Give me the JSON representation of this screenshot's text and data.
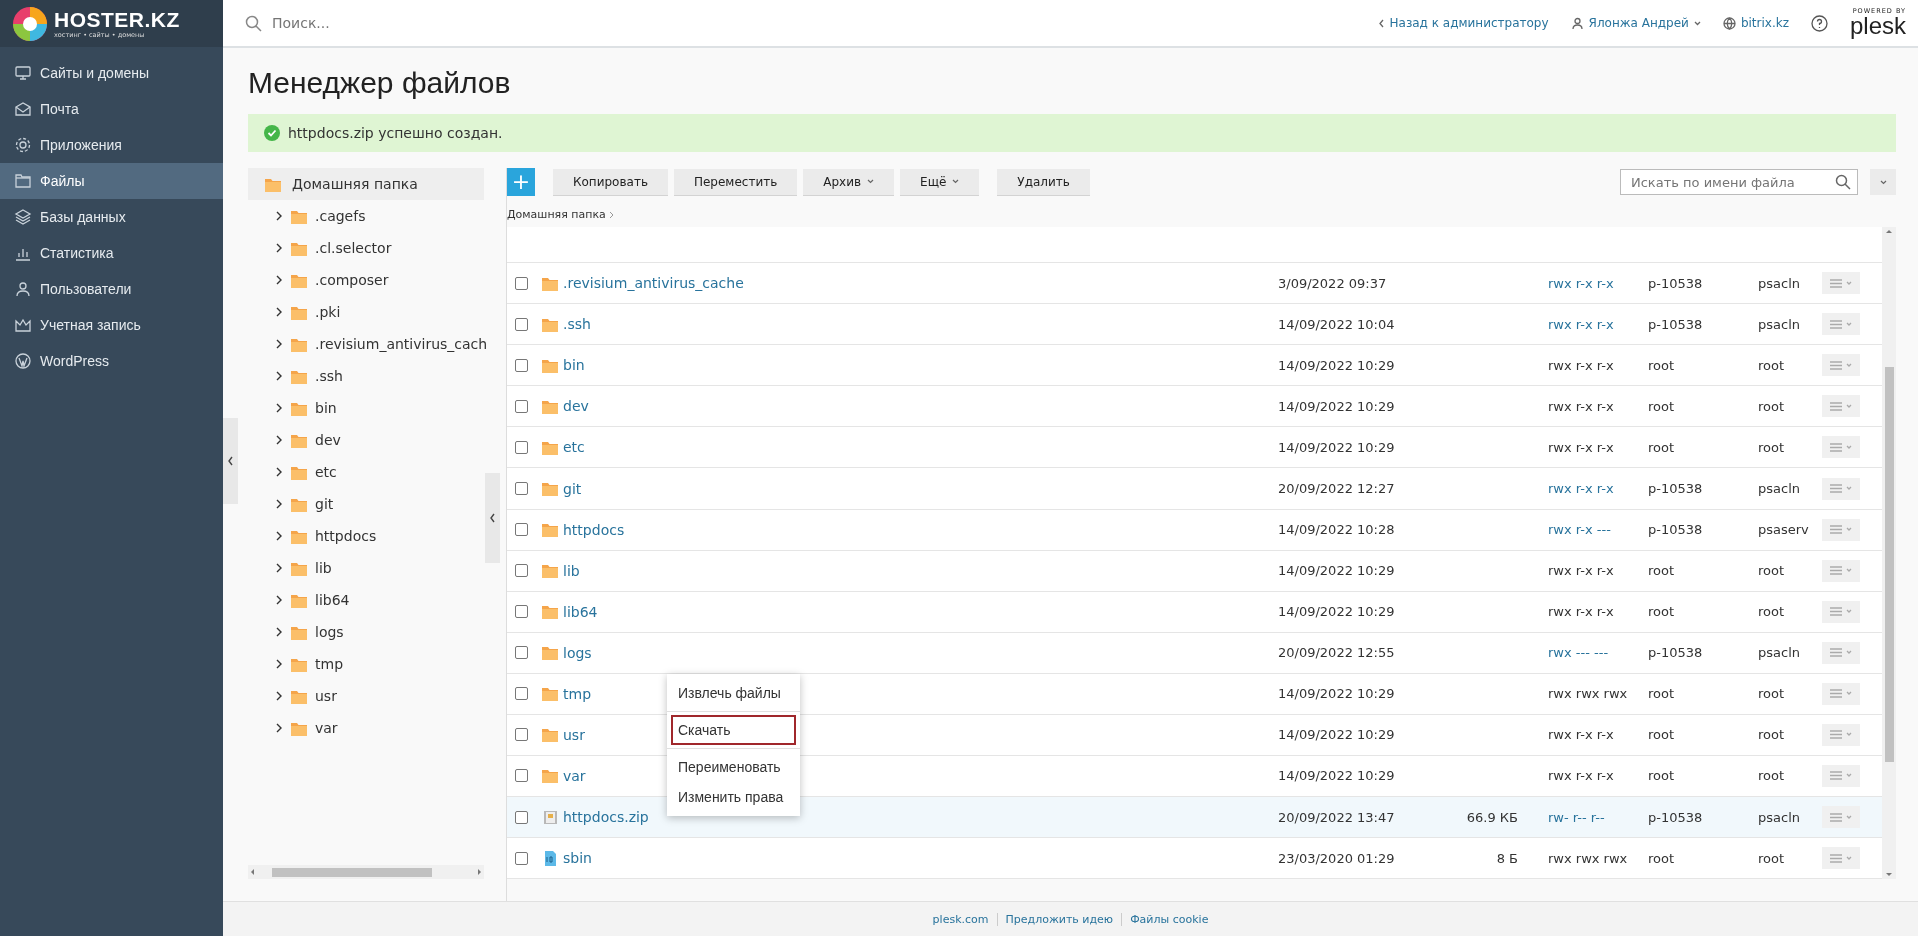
{
  "brand": {
    "name": "HOSTER",
    "suffix": ".KZ",
    "tagline": "хостинг • сайты • домены"
  },
  "sidebar": {
    "items": [
      {
        "label": "Сайты и домены",
        "selected": false
      },
      {
        "label": "Почта",
        "selected": false
      },
      {
        "label": "Приложения",
        "selected": false
      },
      {
        "label": "Файлы",
        "selected": true
      },
      {
        "label": "Базы данных",
        "selected": false
      },
      {
        "label": "Статистика",
        "selected": false
      },
      {
        "label": "Пользователи",
        "selected": false
      },
      {
        "label": "Учетная запись",
        "selected": false
      },
      {
        "label": "WordPress",
        "selected": false
      }
    ]
  },
  "topbar": {
    "search_placeholder": "Поиск...",
    "back_link": "Назад к администратору",
    "user": "Ялонжа Андрей",
    "domain": "bitrix.kz",
    "powered_by": "POWERED BY",
    "plesk": "plesk"
  },
  "page_title": "Менеджер файлов",
  "message": "httpdocs.zip успешно создан.",
  "tree": {
    "root": {
      "label": "Домашняя папка"
    },
    "children": [
      ".cagefs",
      ".cl.selector",
      ".composer",
      ".pki",
      ".revisium_antivirus_cach",
      ".ssh",
      "bin",
      "dev",
      "etc",
      "git",
      "httpdocs",
      "lib",
      "lib64",
      "logs",
      "tmp",
      "usr",
      "var"
    ]
  },
  "toolbar": {
    "add": "+",
    "buttons": [
      {
        "label": "Копировать",
        "dropdown": false
      },
      {
        "label": "Переместить",
        "dropdown": false
      },
      {
        "label": "Архив",
        "dropdown": true
      },
      {
        "label": "Ещё",
        "dropdown": true
      },
      {
        "label": "Удалить",
        "dropdown": false
      }
    ],
    "search_placeholder": "Искать по имени файла"
  },
  "breadcrumb": "Домашняя папка",
  "rows": [
    {
      "name": ".revisium_antivirus_cache",
      "kind": "folder",
      "date": "3/09/2022 09:37",
      "perms": "rwx r-x r-x",
      "perms_link": true,
      "owner": "p-10538",
      "group": "psacln",
      "highlighted": false
    },
    {
      "name": ".ssh",
      "kind": "folder",
      "date": "14/09/2022 10:04",
      "perms": "rwx r-x r-x",
      "perms_link": true,
      "owner": "p-10538",
      "group": "psacln",
      "highlighted": false
    },
    {
      "name": "bin",
      "kind": "folder",
      "date": "14/09/2022 10:29",
      "perms": "rwx r-x r-x",
      "perms_link": false,
      "owner": "root",
      "group": "root",
      "highlighted": false
    },
    {
      "name": "dev",
      "kind": "folder",
      "date": "14/09/2022 10:29",
      "perms": "rwx r-x r-x",
      "perms_link": false,
      "owner": "root",
      "group": "root",
      "highlighted": false
    },
    {
      "name": "etc",
      "kind": "folder",
      "date": "14/09/2022 10:29",
      "perms": "rwx r-x r-x",
      "perms_link": false,
      "owner": "root",
      "group": "root",
      "highlighted": false
    },
    {
      "name": "git",
      "kind": "folder",
      "date": "20/09/2022 12:27",
      "perms": "rwx r-x r-x",
      "perms_link": true,
      "owner": "p-10538",
      "group": "psacln",
      "highlighted": false
    },
    {
      "name": "httpdocs",
      "kind": "folder",
      "date": "14/09/2022 10:28",
      "perms": "rwx r-x ---",
      "perms_link": true,
      "owner": "p-10538",
      "group": "psaserv",
      "highlighted": false
    },
    {
      "name": "lib",
      "kind": "folder",
      "date": "14/09/2022 10:29",
      "perms": "rwx r-x r-x",
      "perms_link": false,
      "owner": "root",
      "group": "root",
      "highlighted": false
    },
    {
      "name": "lib64",
      "kind": "folder",
      "date": "14/09/2022 10:29",
      "perms": "rwx r-x r-x",
      "perms_link": false,
      "owner": "root",
      "group": "root",
      "highlighted": false
    },
    {
      "name": "logs",
      "kind": "folder",
      "date": "20/09/2022 12:55",
      "perms": "rwx --- ---",
      "perms_link": true,
      "owner": "p-10538",
      "group": "psacln",
      "highlighted": false
    },
    {
      "name": "tmp",
      "kind": "folder",
      "date": "14/09/2022 10:29",
      "perms": "rwx rwx rwx",
      "perms_link": false,
      "owner": "root",
      "group": "root",
      "highlighted": false
    },
    {
      "name": "usr",
      "kind": "folder",
      "date": "14/09/2022 10:29",
      "perms": "rwx r-x r-x",
      "perms_link": false,
      "owner": "root",
      "group": "root",
      "highlighted": false
    },
    {
      "name": "var",
      "kind": "folder",
      "date": "14/09/2022 10:29",
      "perms": "rwx r-x r-x",
      "perms_link": false,
      "owner": "root",
      "group": "root",
      "highlighted": false
    },
    {
      "name": "httpdocs.zip",
      "kind": "archive",
      "date": "20/09/2022 13:47",
      "size": "66.9 КБ",
      "perms": "rw- r-- r--",
      "perms_link": true,
      "owner": "p-10538",
      "group": "psacln",
      "highlighted": true
    },
    {
      "name": "sbin",
      "kind": "binary",
      "date": "23/03/2020 01:29",
      "size": "8 Б",
      "perms": "rwx rwx rwx",
      "perms_link": false,
      "owner": "root",
      "group": "root",
      "highlighted": false
    }
  ],
  "context_menu": {
    "groups": [
      {
        "items": [
          {
            "label": "Извлечь файлы",
            "selected": false
          }
        ]
      },
      {
        "items": [
          {
            "label": "Скачать",
            "selected": true
          }
        ]
      },
      {
        "items": [
          {
            "label": "Переименовать",
            "selected": false
          },
          {
            "label": "Изменить права",
            "selected": false
          }
        ]
      }
    ]
  },
  "footer": {
    "links": [
      "plesk.com",
      "Предложить идею",
      "Файлы cookie"
    ]
  }
}
